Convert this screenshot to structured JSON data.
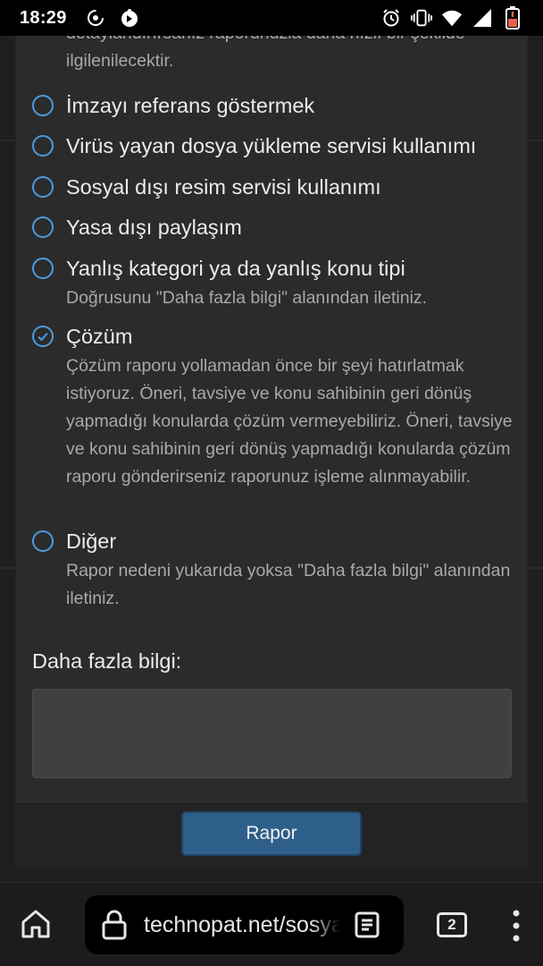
{
  "status_bar": {
    "time": "18:29",
    "left_icons": [
      "data-saver-icon",
      "app-notification-icon"
    ],
    "right_icons": [
      "alarm-icon",
      "vibrate-icon",
      "wifi-icon",
      "signal-icon",
      "battery-low-icon"
    ]
  },
  "report_form": {
    "intro_text": "detaylandırırsanız raporunuzla daha hızlı bir şekilde ilgilenilecektir.",
    "options": [
      {
        "label": "İmzayı referans göstermek",
        "description": "",
        "selected": false
      },
      {
        "label": "Virüs yayan dosya yükleme servisi kullanımı",
        "description": "",
        "selected": false
      },
      {
        "label": "Sosyal dışı resim servisi kullanımı",
        "description": "",
        "selected": false
      },
      {
        "label": "Yasa dışı paylaşım",
        "description": "",
        "selected": false
      },
      {
        "label": "Yanlış kategori ya da yanlış konu tipi",
        "description": "Doğrusunu \"Daha fazla bilgi\" alanından iletiniz.",
        "selected": false
      },
      {
        "label": "Çözüm",
        "description": "Çözüm raporu yollamadan önce bir şeyi hatırlatmak istiyoruz. Öneri, tavsiye ve konu sahibinin geri dönüş yapmadığı konularda çözüm vermeyebiliriz. Öneri, tavsiye ve konu sahibinin geri dönüş yapmadığı konularda çözüm raporu gönderirseniz raporunuz işleme alınmayabilir.",
        "selected": true
      },
      {
        "label": "Diğer",
        "description": "Rapor nedeni yukarıda yoksa \"Daha fazla bilgi\" alanından iletiniz.",
        "selected": false
      }
    ],
    "more_info_label": "Daha fazla bilgi:",
    "more_info_value": "",
    "submit_label": "Rapor"
  },
  "browser": {
    "url": "technopat.net/sosyal",
    "tab_count": "2"
  },
  "colors": {
    "accent": "#4d9be0",
    "button": "#2e5f8a",
    "modal_bg": "#2b2b2b"
  }
}
